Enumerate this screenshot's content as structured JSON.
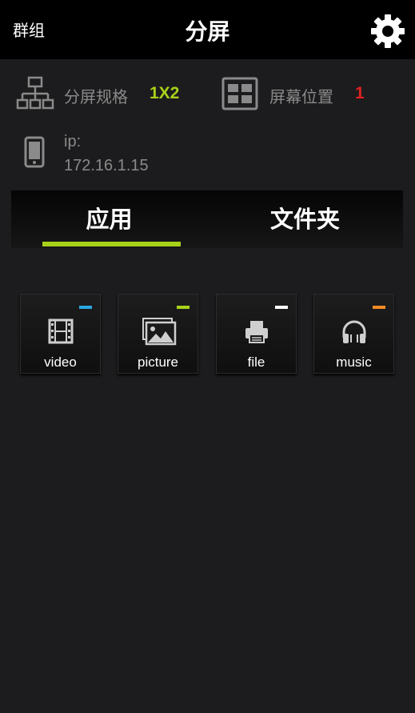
{
  "header": {
    "left_label": "群组",
    "title": "分屏",
    "settings_icon": "gear-icon"
  },
  "info": {
    "split_label": "分屏规格",
    "split_value": "1X2",
    "position_label": "屏幕位置",
    "position_value": "1",
    "ip_label": "ip:",
    "ip_value": "172.16.1.15"
  },
  "tabs": [
    {
      "label": "应用",
      "active": true
    },
    {
      "label": "文件夹",
      "active": false
    }
  ],
  "apps": [
    {
      "label": "video",
      "icon": "film-icon",
      "accent": "#2aa7e0"
    },
    {
      "label": "picture",
      "icon": "image-icon",
      "accent": "#a8d11a"
    },
    {
      "label": "file",
      "icon": "printer-icon",
      "accent": "#ffffff"
    },
    {
      "label": "music",
      "icon": "headphones-icon",
      "accent": "#f08a24"
    }
  ],
  "colors": {
    "accent_green": "#a8d11a",
    "accent_red": "#e02020",
    "background": "#1c1c1e"
  }
}
